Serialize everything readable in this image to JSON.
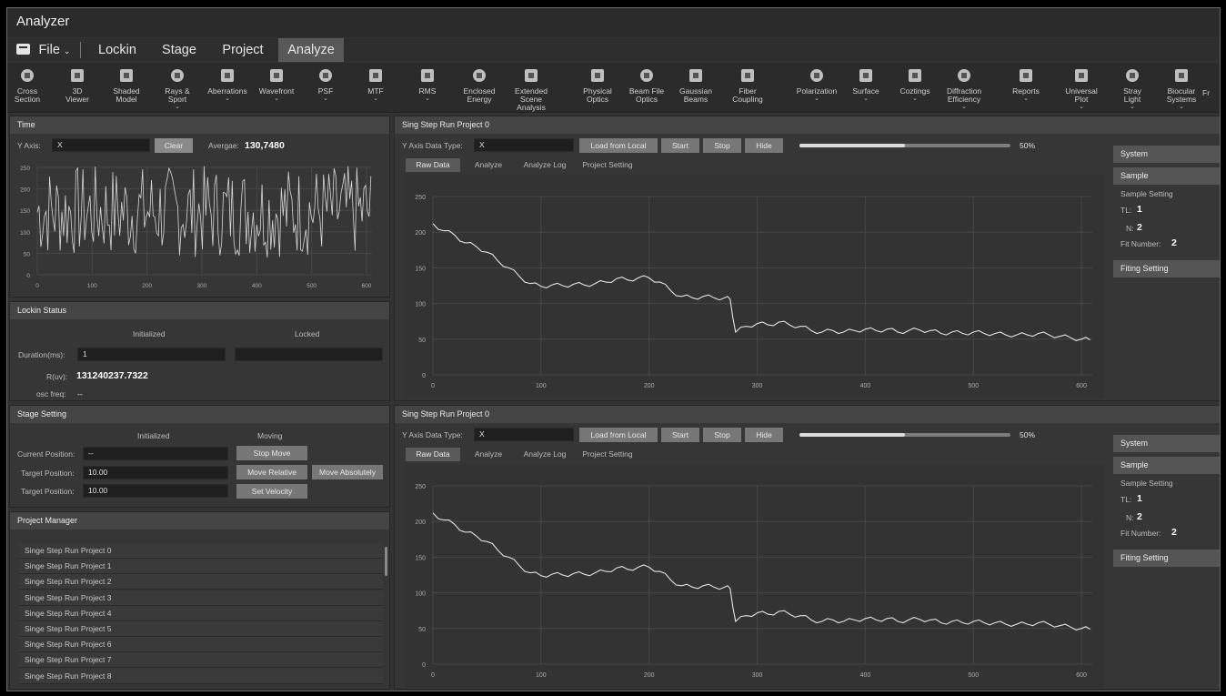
{
  "window": {
    "title": "Analyzer"
  },
  "menu": {
    "file": "File",
    "items": [
      "Lockin",
      "Stage",
      "Project",
      "Analyze"
    ],
    "active": "Analyze"
  },
  "toolbar": [
    {
      "label": "Cross\nSection",
      "icon": "cross-section-icon",
      "dropdown": false
    },
    {
      "label": "3D\nViewer",
      "icon": "3d-viewer-icon",
      "dropdown": false
    },
    {
      "label": "Shaded\nModel",
      "icon": "shaded-model-icon",
      "dropdown": false
    },
    {
      "label": "Rays &\nSport",
      "icon": "rays-icon",
      "dropdown": true
    },
    {
      "label": "Aberrations",
      "icon": "aberrations-icon",
      "dropdown": true
    },
    {
      "label": "Wavefront",
      "icon": "wavefront-icon",
      "dropdown": true
    },
    {
      "label": "PSF",
      "icon": "psf-icon",
      "dropdown": true
    },
    {
      "label": "MTF",
      "icon": "mtf-icon",
      "dropdown": true
    },
    {
      "label": "RMS",
      "icon": "rms-icon",
      "dropdown": true
    },
    {
      "label": "Enclosed\nEnergy",
      "icon": "enclosed-energy-icon",
      "dropdown": false
    },
    {
      "label": "Extended Scene\nAnalysis",
      "icon": "extended-scene-icon",
      "dropdown": false
    },
    {
      "label": "Physical\nOptics",
      "icon": "physical-optics-icon",
      "dropdown": false
    },
    {
      "label": "Beam File\nOptics",
      "icon": "beam-file-icon",
      "dropdown": false
    },
    {
      "label": "Gaussian\nBeams",
      "icon": "gaussian-beams-icon",
      "dropdown": false
    },
    {
      "label": "Fiber\nCoupling",
      "icon": "fiber-coupling-icon",
      "dropdown": false
    },
    {
      "label": "Polarization",
      "icon": "polarization-icon",
      "dropdown": true
    },
    {
      "label": "Surface",
      "icon": "surface-icon",
      "dropdown": true
    },
    {
      "label": "Coztings",
      "icon": "coatings-icon",
      "dropdown": true
    },
    {
      "label": "Diffraction\nEfficiency",
      "icon": "diffraction-icon",
      "dropdown": true
    },
    {
      "label": "Reports",
      "icon": "reports-icon",
      "dropdown": true
    },
    {
      "label": "Universal\nPlot",
      "icon": "universal-plot-icon",
      "dropdown": true
    },
    {
      "label": "Stray\nLight",
      "icon": "stray-light-icon",
      "dropdown": true
    },
    {
      "label": "Biocular\nSystems",
      "icon": "biocular-icon",
      "dropdown": true
    },
    {
      "label": "Fr",
      "icon": "",
      "dropdown": false
    }
  ],
  "time_panel": {
    "title": "Time",
    "y_axis_label": "Y Axis:",
    "y_axis_value": "X",
    "clear": "Clear",
    "average_label": "Avergae:",
    "average_value": "130,7480",
    "y_ticks": [
      "250",
      "200",
      "150",
      "100",
      "50",
      "0"
    ],
    "x_ticks": [
      "0",
      "100",
      "200",
      "300",
      "400",
      "500",
      "600"
    ]
  },
  "lockin_panel": {
    "title": "Lockin Status",
    "col1": "Initialized",
    "col2": "Locked",
    "duration_label": "Duration(ms):",
    "duration_value": "1",
    "r_label": "R(uv):",
    "r_value": "131240237.7322",
    "osc_label": "osc freq:",
    "osc_value": "--"
  },
  "stage_panel": {
    "title": "Stage Setting",
    "col1": "Initialized",
    "col2": "Moving",
    "current_label": "Current Position:",
    "current_value": "--",
    "target1_label": "Target Position:",
    "target1_value": "10.00",
    "target2_label": "Target Position:",
    "target2_value": "10.00",
    "stop_move": "Stop Move",
    "move_relative": "Move Relative",
    "move_absolutely": "Move Absolutely",
    "set_velocity": "Set Velocity"
  },
  "project_manager": {
    "title": "Project Manager",
    "items": [
      "Singe Step Run Project 0",
      "Singe Step Run Project 1",
      "Singe Step Run Project 2",
      "Singe Step Run Project 3",
      "Singe Step Run Project 4",
      "Singe Step Run Project 5",
      "Singe Step Run Project 6",
      "Singe Step Run Project 7",
      "Singe Step Run Project 8"
    ]
  },
  "run_panels": [
    {
      "title": "Sing Step Run Project 0",
      "y_axis_label": "Y Axis Data Type:",
      "y_axis_value": "X",
      "load": "Load from Local",
      "start": "Start",
      "stop": "Stop",
      "hide": "Hide",
      "progress": 0.5,
      "progress_text": "50%",
      "tabs": [
        "Raw Data",
        "Analyze",
        "Analyze Log",
        "Project Setting"
      ],
      "side": {
        "system": "System",
        "sample": "Sample",
        "sample_setting": "Sample Setting",
        "tl_label": "TL:",
        "tl_value": "1",
        "n_label": "N:",
        "n_value": "2",
        "fit_label": "Fit Number:",
        "fit_value": "2",
        "fitting": "Fiting Setting"
      }
    },
    {
      "title": "Sing Step Run Project 0",
      "y_axis_label": "Y Axis Data Type:",
      "y_axis_value": "X",
      "load": "Load from Local",
      "start": "Start",
      "stop": "Stop",
      "hide": "Hide",
      "progress": 0.5,
      "progress_text": "50%",
      "tabs": [
        "Raw Data",
        "Analyze",
        "Analyze Log",
        "Project Setting"
      ],
      "side": {
        "system": "System",
        "sample": "Sample",
        "sample_setting": "Sample Setting",
        "tl_label": "TL:",
        "tl_value": "1",
        "n_label": "N:",
        "n_value": "2",
        "fit_label": "Fit Number:",
        "fit_value": "2",
        "fitting": "Fiting Setting"
      }
    }
  ],
  "chart_data": [
    {
      "type": "line",
      "name": "time",
      "xlim": [
        0,
        610
      ],
      "ylim": [
        0,
        250
      ],
      "x_ticks": [
        0,
        100,
        200,
        300,
        400,
        500,
        600
      ],
      "y_ticks": [
        0,
        50,
        100,
        150,
        200,
        250
      ],
      "seed": 7,
      "min": 40,
      "max": 255,
      "mean": 130.748
    },
    {
      "type": "line",
      "name": "run-0",
      "xlim": [
        0,
        610
      ],
      "ylim": [
        0,
        250
      ],
      "x_ticks": [
        0,
        100,
        200,
        300,
        400,
        500,
        600
      ],
      "y_ticks": [
        0,
        50,
        100,
        150,
        200,
        250
      ],
      "x": [
        0,
        10,
        20,
        30,
        40,
        50,
        60,
        70,
        80,
        90,
        100,
        110,
        120,
        130,
        140,
        150,
        160,
        170,
        180,
        190,
        200,
        210,
        220,
        230,
        240,
        250,
        260,
        270,
        275,
        280,
        290,
        300,
        310,
        320,
        330,
        340,
        350,
        360,
        370,
        380,
        390,
        400,
        410,
        420,
        430,
        440,
        450,
        460,
        470,
        480,
        490,
        500,
        510,
        520,
        530,
        540,
        550,
        560,
        570,
        580,
        590,
        600,
        608
      ],
      "y": [
        212,
        202,
        196,
        185,
        180,
        172,
        160,
        150,
        138,
        128,
        124,
        126,
        125,
        127,
        126,
        128,
        130,
        135,
        133,
        136,
        136,
        130,
        118,
        110,
        108,
        110,
        108,
        108,
        106,
        60,
        68,
        72,
        70,
        74,
        70,
        68,
        62,
        60,
        62,
        60,
        62,
        64,
        62,
        64,
        60,
        62,
        63,
        62,
        58,
        60,
        58,
        60,
        58,
        58,
        56,
        56,
        56,
        58,
        56,
        54,
        52,
        50,
        49
      ]
    },
    {
      "type": "line",
      "name": "run-1",
      "xlim": [
        0,
        610
      ],
      "ylim": [
        0,
        250
      ],
      "x_ticks": [
        0,
        100,
        200,
        300,
        400,
        500,
        600
      ],
      "y_ticks": [
        0,
        50,
        100,
        150,
        200,
        250
      ],
      "x": [
        0,
        10,
        20,
        30,
        40,
        50,
        60,
        70,
        80,
        90,
        100,
        110,
        120,
        130,
        140,
        150,
        160,
        170,
        180,
        190,
        200,
        210,
        220,
        230,
        240,
        250,
        260,
        270,
        275,
        280,
        290,
        300,
        310,
        320,
        330,
        340,
        350,
        360,
        370,
        380,
        390,
        400,
        410,
        420,
        430,
        440,
        450,
        460,
        470,
        480,
        490,
        500,
        510,
        520,
        530,
        540,
        550,
        560,
        570,
        580,
        590,
        600,
        608
      ],
      "y": [
        212,
        202,
        196,
        185,
        180,
        172,
        160,
        150,
        138,
        128,
        124,
        126,
        125,
        127,
        126,
        128,
        130,
        135,
        133,
        136,
        136,
        130,
        118,
        110,
        108,
        110,
        108,
        108,
        106,
        60,
        68,
        72,
        70,
        74,
        70,
        68,
        62,
        60,
        62,
        60,
        62,
        64,
        62,
        64,
        60,
        62,
        63,
        62,
        58,
        60,
        58,
        60,
        58,
        58,
        56,
        56,
        56,
        58,
        56,
        54,
        52,
        50,
        49
      ]
    }
  ]
}
